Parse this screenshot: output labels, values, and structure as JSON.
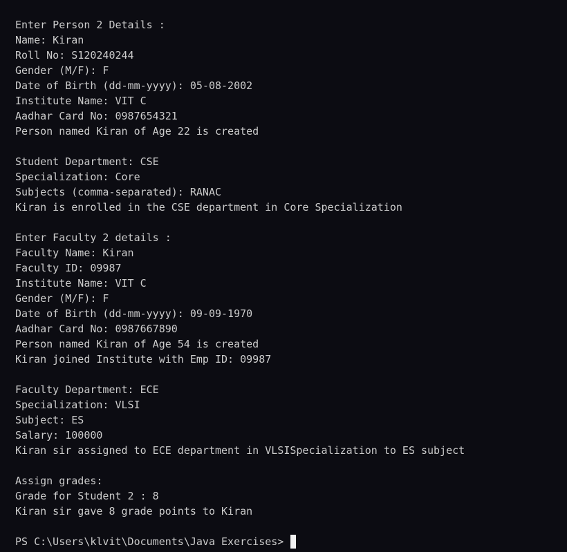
{
  "terminal": {
    "lines": [
      "Enter Person 2 Details :",
      "Name: Kiran",
      "Roll No: S120240244",
      "Gender (M/F): F",
      "Date of Birth (dd-mm-yyyy): 05-08-2002",
      "Institute Name: VIT C",
      "Aadhar Card No: 0987654321",
      "Person named Kiran of Age 22 is created",
      "",
      "Student Department: CSE",
      "Specialization: Core",
      "Subjects (comma-separated): RANAC",
      "Kiran is enrolled in the CSE department in Core Specialization",
      "",
      "Enter Faculty 2 details :",
      "Faculty Name: Kiran",
      "Faculty ID: 09987",
      "Institute Name: VIT C",
      "Gender (M/F): F",
      "Date of Birth (dd-mm-yyyy): 09-09-1970",
      "Aadhar Card No: 0987667890",
      "Person named Kiran of Age 54 is created",
      "Kiran joined Institute with Emp ID: 09987",
      "",
      "Faculty Department: ECE",
      "Specialization: VLSI",
      "Subject: ES",
      "Salary: 100000",
      "Kiran sir assigned to ECE department in VLSISpecialization to ES subject",
      "",
      "Assign grades:",
      "Grade for Student 2 : 8",
      "Kiran sir gave 8 grade points to Kiran",
      ""
    ],
    "prompt": "PS C:\\Users\\klvit\\Documents\\Java Exercises> ",
    "colors": {
      "background": "#0c0c12",
      "text": "#cccccc",
      "cursor": "#f2f2f2"
    }
  }
}
